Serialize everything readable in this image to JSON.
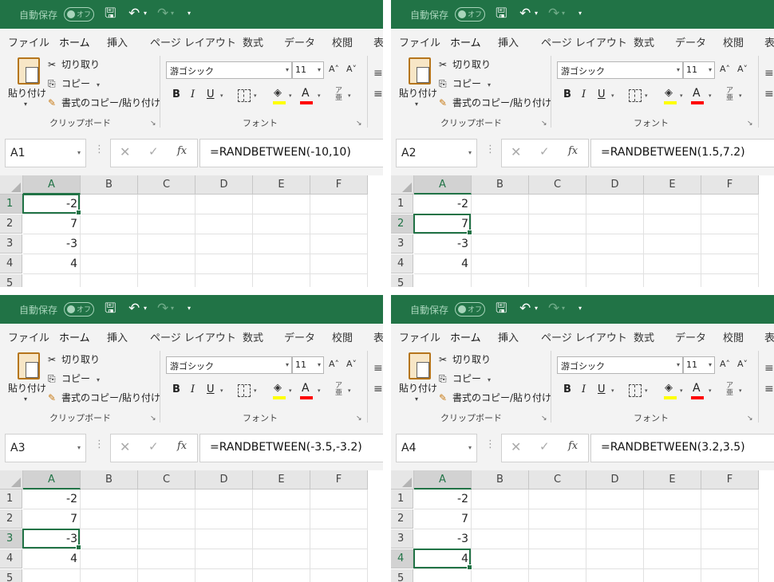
{
  "app": {
    "autosave_label": "自動保存",
    "autosave_state": "オフ",
    "tabs": [
      "ファイル",
      "ホーム",
      "挿入",
      "ページ レイアウト",
      "数式",
      "データ",
      "校閲",
      "表"
    ],
    "active_tab": "ホーム",
    "accent_color": "#217346"
  },
  "ribbon": {
    "clipboard": {
      "paste": "貼り付け",
      "cut": "切り取り",
      "copy": "コピー",
      "format_painter": "書式のコピー/貼り付け",
      "group_label": "クリップボード"
    },
    "font": {
      "font_name": "游ゴシック",
      "font_size": "11",
      "bold": "B",
      "italic": "I",
      "underline": "U",
      "font_color_letter": "A",
      "fill_color": "#ffff00",
      "font_color": "#ff0000",
      "group_label": "フォント"
    }
  },
  "grid": {
    "columns": [
      "A",
      "B",
      "C",
      "D",
      "E",
      "F"
    ],
    "rows": [
      "1",
      "2",
      "3",
      "4",
      "5"
    ],
    "values": [
      "-2",
      "7",
      "-3",
      "4"
    ]
  },
  "panels": [
    {
      "cell": "A1",
      "formula": "=RANDBETWEEN(-10,10)",
      "selected_row": 1
    },
    {
      "cell": "A2",
      "formula": "=RANDBETWEEN(1.5,7.2)",
      "selected_row": 2
    },
    {
      "cell": "A3",
      "formula": "=RANDBETWEEN(-3.5,-3.2)",
      "selected_row": 3
    },
    {
      "cell": "A4",
      "formula": "=RANDBETWEEN(3.2,3.5)",
      "selected_row": 4
    }
  ]
}
